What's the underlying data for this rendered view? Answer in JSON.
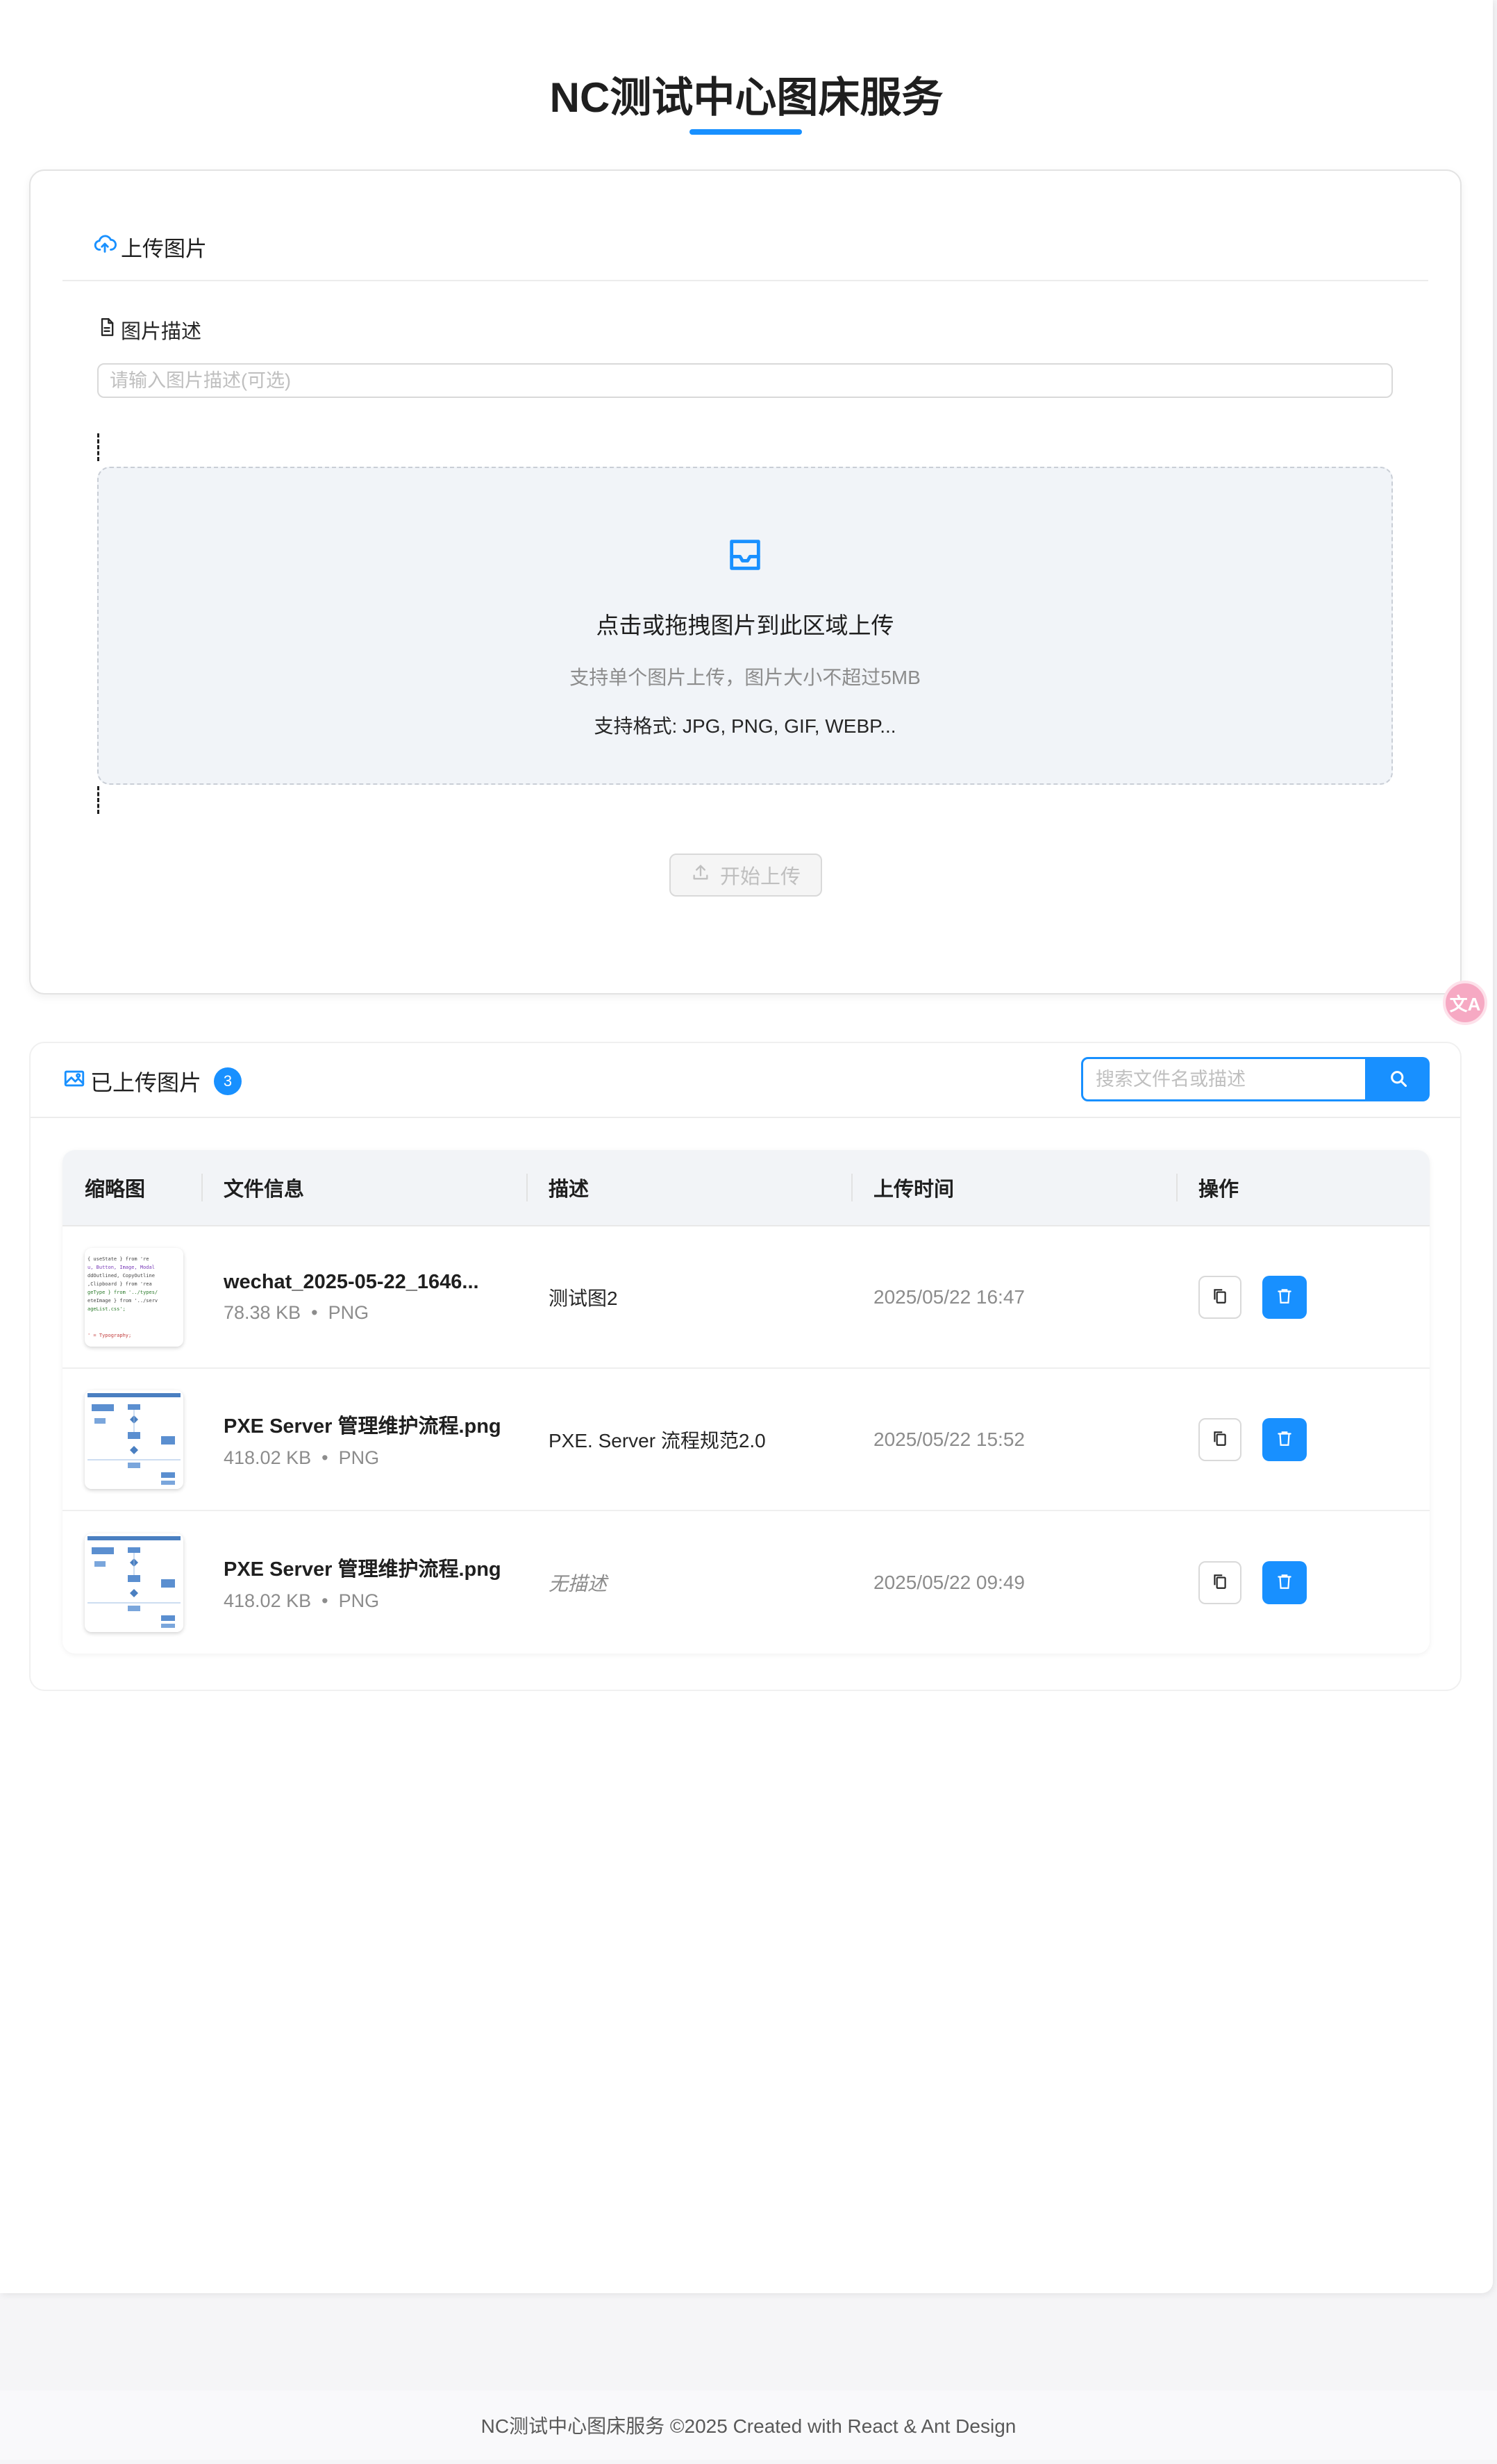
{
  "app": {
    "title": "NC测试中心图床服务",
    "accent_color": "#1890ff"
  },
  "upload": {
    "header": "上传图片",
    "header_icon": "cloud-upload-icon",
    "desc_label": "图片描述",
    "desc_placeholder": "请输入图片描述(可选)",
    "dropzone": {
      "icon": "inbox-icon",
      "main_text": "点击或拖拽图片到此区域上传",
      "hint": "支持单个图片上传，图片大小不超过5MB",
      "formats": "支持格式: JPG, PNG, GIF, WEBP..."
    },
    "start_button": "开始上传"
  },
  "gallery": {
    "header": "已上传图片",
    "count": "3",
    "search_placeholder": "搜索文件名或描述",
    "columns": [
      "缩略图",
      "文件信息",
      "描述",
      "上传时间",
      "操作"
    ],
    "rows": [
      {
        "thumb": "code-thumbnail",
        "filename": "wechat_2025-05-22_1646...",
        "size": "78.38 KB",
        "type": "PNG",
        "description": "测试图2",
        "time": "2025/05/22 16:47"
      },
      {
        "thumb": "flowchart-thumbnail",
        "filename": "PXE Server 管理维护流程.png",
        "size": "418.02 KB",
        "type": "PNG",
        "description": "PXE. Server 流程规范2.0",
        "time": "2025/05/22 15:52"
      },
      {
        "thumb": "flowchart-thumbnail",
        "filename": "PXE Server 管理维护流程.png",
        "size": "418.02 KB",
        "type": "PNG",
        "description": "无描述",
        "time": "2025/05/22 09:49"
      }
    ]
  },
  "footer": {
    "text": "NC测试中心图床服务 ©2025 Created with React & Ant Design"
  }
}
